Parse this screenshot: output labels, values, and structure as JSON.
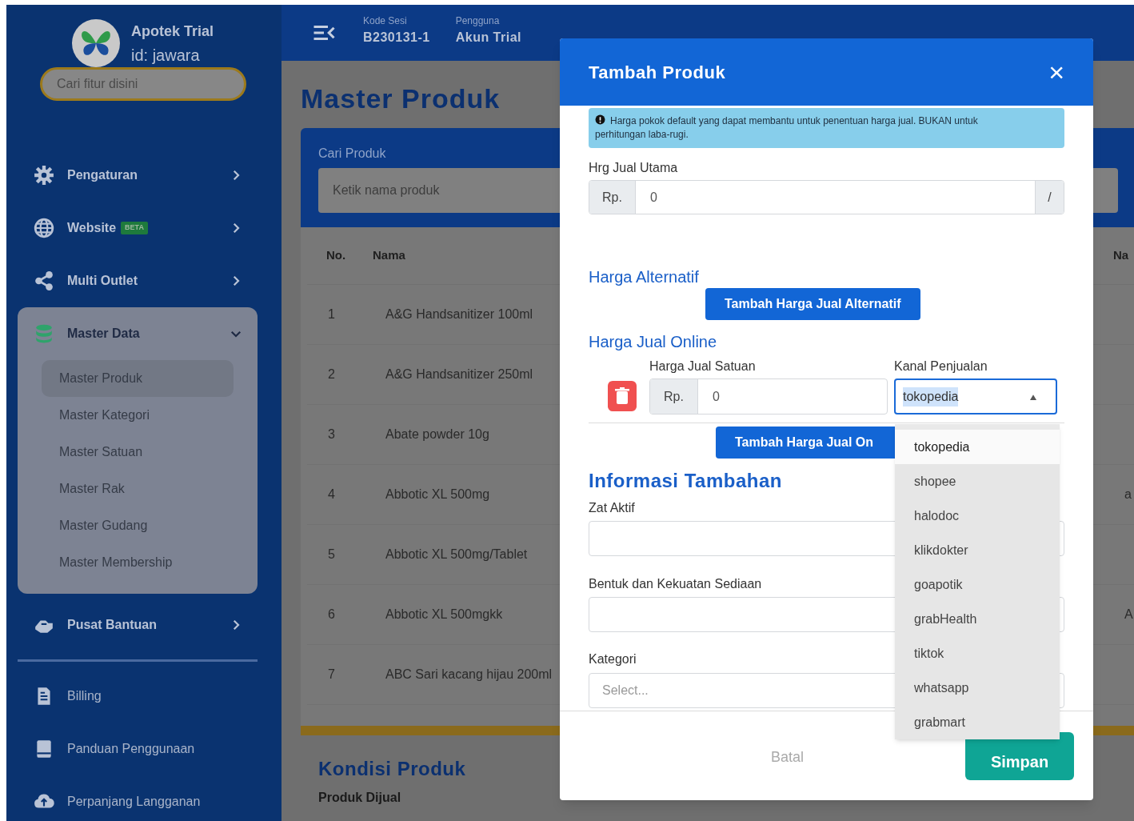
{
  "sidebar": {
    "brand": {
      "name": "Apotek Trial",
      "id": "id: jawara"
    },
    "search": {
      "placeholder": "Cari fitur disini"
    },
    "items": [
      {
        "label": "Pengaturan",
        "expanded": false
      },
      {
        "label": "Website",
        "badge": "BETA",
        "expanded": false
      },
      {
        "label": "Multi Outlet",
        "expanded": false
      },
      {
        "label": "Master Data",
        "expanded": true,
        "children": [
          {
            "label": "Master Produk",
            "selected": true
          },
          {
            "label": "Master Kategori",
            "selected": false
          },
          {
            "label": "Master Satuan",
            "selected": false
          },
          {
            "label": "Master Rak",
            "selected": false
          },
          {
            "label": "Master Gudang",
            "selected": false
          },
          {
            "label": "Master Membership",
            "selected": false
          }
        ]
      },
      {
        "label": "Pusat Bantuan",
        "expanded": false
      }
    ],
    "links": [
      {
        "label": "Billing"
      },
      {
        "label": "Panduan Penggunaan"
      },
      {
        "label": "Perpanjang Langganan"
      }
    ]
  },
  "topbar": {
    "session": {
      "label": "Kode Sesi",
      "value": "B230131-1"
    },
    "user": {
      "label": "Pengguna",
      "value": "Akun Trial"
    }
  },
  "page": {
    "title": "Master Produk",
    "search": {
      "label": "Cari Produk",
      "placeholder": "Ketik nama produk"
    },
    "table": {
      "columns": [
        "No.",
        "Nama",
        "Na"
      ],
      "rows": [
        {
          "no": "1",
          "name": "A&G Handsanitizer 100ml"
        },
        {
          "no": "2",
          "name": "A&G Handsanitizer 250ml"
        },
        {
          "no": "3",
          "name": "Abate powder 10g"
        },
        {
          "no": "4",
          "name": "Abbotic XL 500mg",
          "column_3": "a"
        },
        {
          "no": "5",
          "name": "Abbotic XL 500mg/Tablet"
        },
        {
          "no": "6",
          "name": "Abbotic XL 500mgkk",
          "column_3": "A"
        },
        {
          "no": "7",
          "name": "ABC Sari kacang hijau 200ml"
        }
      ]
    },
    "section": {
      "title": "Kondisi Produk",
      "label": "Produk Dijual"
    }
  },
  "modal": {
    "title": "Tambah Produk",
    "close": "×",
    "alert": "Harga pokok default yang dapat membantu untuk penentuan harga jual. BUKAN untuk perhitungan laba-rugi.",
    "main_price": {
      "label": "Hrg Jual Utama",
      "prefix": "Rp.",
      "value": "0",
      "suffix": "/"
    },
    "alt_price": {
      "title": "Harga Alternatif",
      "button": "Tambah Harga Jual Alternatif"
    },
    "online_price": {
      "title": "Harga Jual Online",
      "price_label": "Harga Jual Satuan",
      "prefix": "Rp.",
      "value": "0",
      "channel_label": "Kanal Penjualan",
      "channel": "tokopedia",
      "button": "Tambah Harga Jual On",
      "options": [
        {
          "label": "tokopedia",
          "selected": true
        },
        {
          "label": "shopee",
          "selected": false
        },
        {
          "label": "halodoc",
          "selected": false
        },
        {
          "label": "klikdokter",
          "selected": false
        },
        {
          "label": "goapotik",
          "selected": false
        },
        {
          "label": "grabHealth",
          "selected": false
        },
        {
          "label": "tiktok",
          "selected": false
        },
        {
          "label": "whatsapp",
          "selected": false
        },
        {
          "label": "grabmart",
          "selected": false
        }
      ]
    },
    "info": {
      "title": "Informasi Tambahan",
      "fields": [
        {
          "label": "Zat Aktif"
        },
        {
          "label": "Bentuk dan Kekuatan Sediaan"
        },
        {
          "label": "Kategori",
          "placeholder": "Select..."
        }
      ]
    },
    "buttons": {
      "cancel": "Batal",
      "save": "Simpan"
    }
  }
}
